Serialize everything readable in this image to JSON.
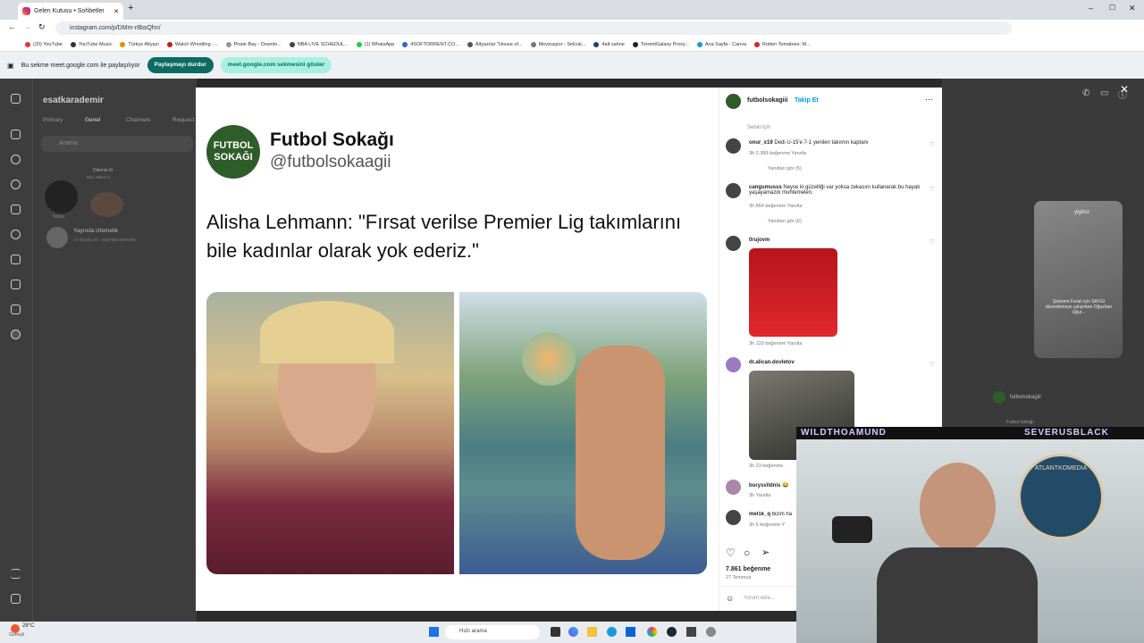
{
  "browser": {
    "tab_title": "Gelen Kutusu • Sohbetler",
    "url": "instagram.com/p/DMm-r8bsQhn/",
    "bookmarks": [
      "(20) YouTube",
      "YouTube Music",
      "Türkçe Altyazı",
      "Watch Wrestling -...",
      "Pirate Bay - Downlo...",
      "NBA LIVE SCHEDUL...",
      "(1) WhatsApp",
      "4SOFTORRENT.CO...",
      "Altyazılar \"House of...",
      "Mevzuspor - Selcuk...",
      "4alt sahne",
      "TorrentGalaxy Proxy...",
      "Ana Sayfa - Canva",
      "Rotten Tomatoes: M..."
    ]
  },
  "share": {
    "notice": "Bu sekme meet.google.com ile paylaşılıyor",
    "stop": "Paylaşmayı durdur",
    "show": "meet.google.com sekmesini göster"
  },
  "inbox": {
    "username": "esatkarademir",
    "tabs": [
      "Primary",
      "Genel",
      "Channels",
      "Request"
    ],
    "search": "Arama",
    "live_title": "Yayında izlemelik",
    "live_sub": "5+ Başka ek...yayında izlemelik",
    "note1": "Notun",
    "note2": "Dikenin Ki",
    "note2_sub": "Dizu Takım T..."
  },
  "post": {
    "account": "Futbol Sokağı",
    "handle": "@futbolsokaagii",
    "logo": "FUTBOL SOKAĞI",
    "quote": "Alisha Lehmann: \"Fırsat verilse Premier Lig takımlarını bile kadınlar olarak yok ederiz.\""
  },
  "side": {
    "user": "futbolsokagiii",
    "follow": "Takip Et",
    "for_you": "Senin için",
    "comments": [
      {
        "user": "onur_x19",
        "text": "Dedi U-15'e 7-1 yenilen takımın kaptanı",
        "meta": "3h   2.389 beğenme   Yanıtla",
        "replies": "Yanıtları gör (5)"
      },
      {
        "user": "cangumusss",
        "text": "Neyse ki güzelliği var yoksa zekasını kullanarak bu hayatı yaşayamazdı muhtemelen.",
        "meta": "3h   864 beğenme   Yanıtla",
        "replies": "Yanıtları gör (6)"
      },
      {
        "user": "0rujovm",
        "text": "",
        "meta": "3h   129 beğenme   Yanıtla"
      },
      {
        "user": "dr.alican.dovletov",
        "text": "",
        "meta": "3h   23 beğenme"
      },
      {
        "user": "burysvildnis",
        "text": "😂",
        "meta": "3h   Yanıtla"
      },
      {
        "user": "mel1k_q",
        "text": "bizim ha",
        "meta": "3h   5 beğenme   Y"
      }
    ],
    "likes": "7.861 beğenme",
    "date": "27 Temmuz",
    "add_comment": "Yorum ekle..."
  },
  "right": {
    "story_user": "yigitoz",
    "story_text": "Şebnem Ferah için SAYGI düzenlemeye çalışırken Oğuzhan Uğur...",
    "chat1": "futbolsokagiii",
    "chat2": "Futbol Sokağı"
  },
  "overlay": {
    "left": "WILDTHOAMUND",
    "right": "SEVERUSBLACK",
    "badge": "ATLANTKOMEDIA"
  },
  "taskbar": {
    "temp": "28°C",
    "weather": "Güneşli",
    "search": "Hızlı arama"
  }
}
